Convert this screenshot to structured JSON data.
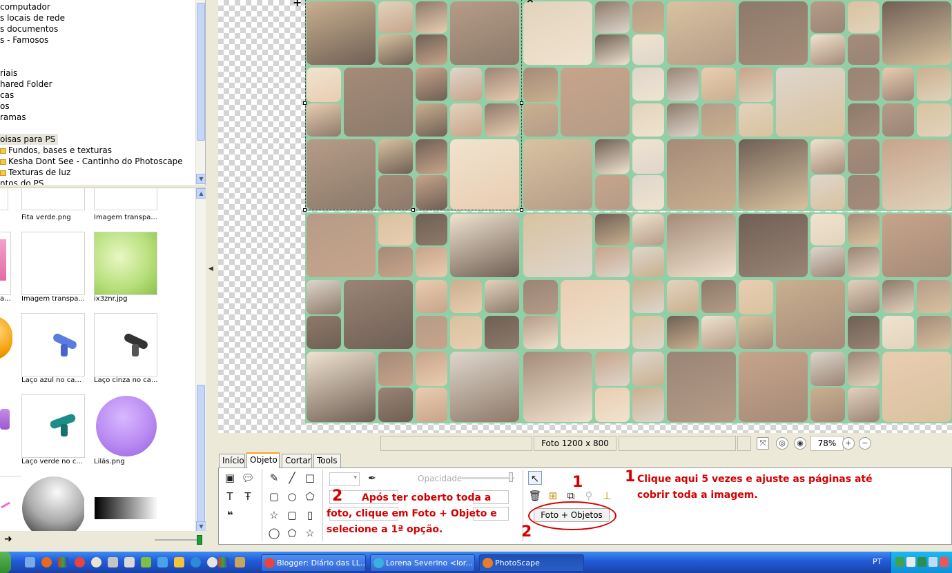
{
  "tree": {
    "items": [
      {
        "label": "computador"
      },
      {
        "label": "s locais de rede"
      },
      {
        "label": "s documentos"
      },
      {
        "label": "s - Famosos"
      },
      {
        "label": "riais"
      },
      {
        "label": "hared Folder"
      },
      {
        "label": "cas"
      },
      {
        "label": "os"
      },
      {
        "label": "ramas"
      },
      {
        "label": "oisas para PS"
      },
      {
        "label": "Fundos, bases e texturas"
      },
      {
        "label": "Kesha Dont See - Cantinho do Photoscape"
      },
      {
        "label": "Texturas de luz"
      },
      {
        "label": "ntos do PS"
      }
    ]
  },
  "thumbnails": {
    "items": [
      {
        "caption": "Fita verde.png"
      },
      {
        "caption": "Imagem transpa..."
      },
      {
        "caption": "a..."
      },
      {
        "caption": "Imagem transpa..."
      },
      {
        "caption": "ix3znr.jpg"
      },
      {
        "caption": "Laço azul no ca..."
      },
      {
        "caption": "Laço cinza no ca..."
      },
      {
        "caption": "Laço verde no c..."
      },
      {
        "caption": "Lilás.png"
      }
    ]
  },
  "status": {
    "photo_size": "Foto 1200 x 800",
    "zoom": "78%"
  },
  "tabs": [
    {
      "label": "Início"
    },
    {
      "label": "Objeto"
    },
    {
      "label": "Cortar"
    },
    {
      "label": "Tools"
    }
  ],
  "panel": {
    "opacity_label": "Opacidade",
    "foto_objetos_label": "Foto + Objetos"
  },
  "annotations": {
    "num_1a": "1",
    "num_1b": "1",
    "num_2a": "2",
    "num_2b": "2",
    "text_1_line1": "Clique aqui 5 vezes e ajuste as páginas até",
    "text_1_line2": "cobrir toda a imagem.",
    "text_2_line1": "Após ter coberto toda a",
    "text_2_line2": "foto, clique em Foto + Objeto e",
    "text_2_line3": "selecione a 1ª opção."
  },
  "taskbar": {
    "tasks": [
      {
        "label": "Blogger: Diário das LL...",
        "icon_color": "#e8453c"
      },
      {
        "label": "Lorena Severino <lor...",
        "icon_color": "#3ab0e2"
      },
      {
        "label": "PhotoScape",
        "icon_color": "#e87d2a"
      }
    ],
    "language": "PT"
  },
  "colors": {
    "page_green": "#92cfa6",
    "annotation_red": "#d40000",
    "taskbar_blue": "#245edb"
  }
}
